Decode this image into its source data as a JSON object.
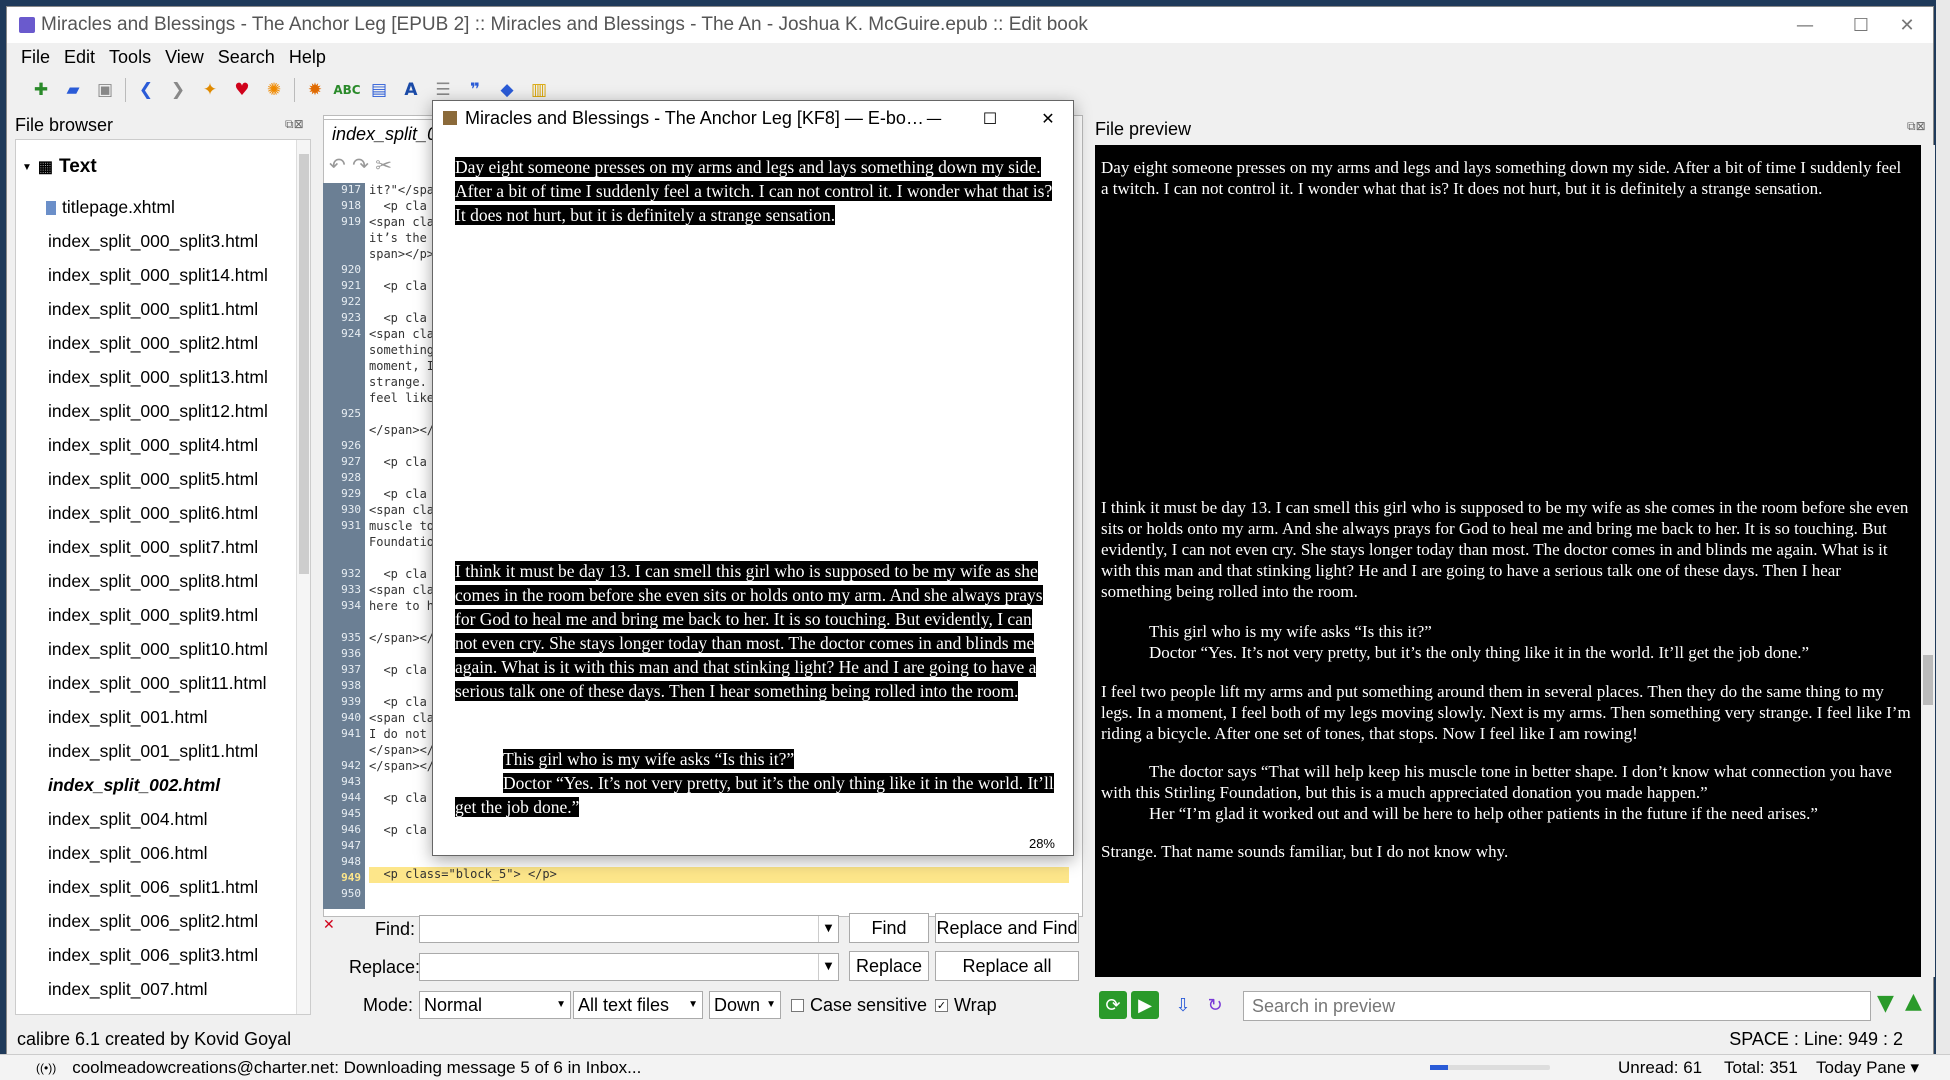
{
  "window": {
    "title": "Miracles and Blessings - The Anchor Leg [EPUB 2] :: Miracles and Blessings - The An - Joshua K. McGuire.epub :: Edit book",
    "minimize": "—",
    "maximize": "☐",
    "close": "✕"
  },
  "menu": [
    "File",
    "Edit",
    "Tools",
    "View",
    "Search",
    "Help"
  ],
  "file_browser": {
    "header": "File browser",
    "root": "Text",
    "items": [
      "titlepage.xhtml",
      "index_split_000_split3.html",
      "index_split_000_split14.html",
      "index_split_000_split1.html",
      "index_split_000_split2.html",
      "index_split_000_split13.html",
      "index_split_000_split12.html",
      "index_split_000_split4.html",
      "index_split_000_split5.html",
      "index_split_000_split6.html",
      "index_split_000_split7.html",
      "index_split_000_split8.html",
      "index_split_000_split9.html",
      "index_split_000_split10.html",
      "index_split_000_split11.html",
      "index_split_001.html",
      "index_split_001_split1.html",
      "index_split_002.html",
      "index_split_004.html",
      "index_split_006.html",
      "index_split_006_split1.html",
      "index_split_006_split2.html",
      "index_split_006_split3.html",
      "index_split_007.html"
    ],
    "active_item": "index_split_002.html"
  },
  "editor": {
    "tab": "index_split_0",
    "gutter": [
      "917",
      "918",
      "919",
      "",
      "",
      "920",
      "921",
      "922",
      "923",
      "924",
      "",
      "",
      "",
      "",
      "925",
      "",
      "926",
      "927",
      "928",
      "929",
      "930",
      "931",
      "",
      "",
      "932",
      "933",
      "934",
      "",
      "935",
      "936",
      "937",
      "938",
      "939",
      "940",
      "941",
      "",
      "942",
      "943",
      "944",
      "945",
      "946",
      "947",
      "948",
      "949",
      "950"
    ],
    "lines": [
      "it?\"</spa",
      "  <p cla",
      "<span cla",
      "it’s the ",
      "span></p>",
      "",
      "  <p cla",
      "",
      "  <p cla",
      "<span cla",
      "something",
      "moment, I",
      "strange.",
      "feel like",
      "",
      "</span></",
      "",
      "  <p cla",
      "",
      "  <p cla",
      "<span cla",
      "muscle to",
      "Foundatio",
      "",
      "  <p cla",
      "<span cla",
      "here to h",
      "",
      "</span></",
      "",
      "  <p cla",
      "",
      "  <p cla",
      "<span cla",
      "I do not ",
      "</span></",
      "</span></",
      "",
      "  <p cla",
      "",
      "  <p cla",
      ""
    ],
    "current_line": "  <p class=\"block_5\"> </p>"
  },
  "popup": {
    "title": "Miracles and Blessings - The Anchor Leg [KF8] — E-bo…",
    "para1": "Day eight someone presses on my arms and legs and lays something down my side. After a bit of time I suddenly feel a twitch. I can not control it. I wonder what that is? It does not hurt, but it is definitely a strange sensation.",
    "para2": "I think it must be day 13. I can smell this girl who is supposed to be my wife as she comes in the room before she even sits or holds onto my arm. And she always prays for God to heal me and bring me back to her. It is so touching. But evidently, I can not even cry. She stays longer today than most. The doctor comes in and blinds me again. What is it with this man and that stinking light? He and I are going to have a serious talk one of these days. Then I hear something being rolled into the room.",
    "para3a": "This girl who is my wife asks “Is this it?”",
    "para3b": "Doctor “Yes. It’s not very pretty, but it’s the only thing like it in the world. It’ll get the job done.”",
    "percent": "28%"
  },
  "find_replace": {
    "find_label": "Find:",
    "replace_label": "Replace:",
    "mode_label": "Mode:",
    "find_btn": "Find",
    "replace_find_btn": "Replace and Find",
    "replace_btn": "Replace",
    "replace_all_btn": "Replace all",
    "mode_value": "Normal",
    "scope_value": "All text files",
    "direction_value": "Down",
    "case_label": "Case sensitive",
    "wrap_label": "Wrap"
  },
  "file_preview": {
    "header": "File preview",
    "p1": "Day eight someone presses on my arms and legs and lays something down my side. After a bit of time I suddenly feel a twitch. I can not control it. I wonder what that is? It does not hurt, but it is definitely a strange sensation.",
    "p2": "I think it must be day 13. I can smell this girl who is supposed to be my wife as she comes in the room before she even sits or holds onto my arm. And she always prays for God to heal me and bring me back to her. It is so touching. But evidently, I can not even cry. She stays longer today than most. The doctor comes in and blinds me again. What is it with this man and that stinking light? He and I are going to have a serious talk one of these days. Then I hear something being rolled into the room.",
    "p3a": "This girl who is my wife asks “Is this it?”",
    "p3b": "Doctor “Yes. It’s not very pretty, but it’s the only thing like it in the world. It’ll get the job done.”",
    "p4": "I feel two people lift my arms and put something around them in several places. Then they do the same thing to my legs. In a moment, I feel both of my legs moving slowly. Next is my arms. Then something very strange. I feel like I’m riding a bicycle. After one set of tones, that stops. Now I feel like I am rowing!",
    "p5a": "The doctor says “That will help keep his muscle tone in better shape. I don’t know what connection you have with this Stirling Foundation, but this is a much appreciated donation you made happen.”",
    "p5b": "Her “I’m glad it worked out and will be here to help other patients in the future if the need arises.”",
    "p6": "Strange. That name sounds familiar, but I do not know why.",
    "search_placeholder": "Search in preview"
  },
  "status": {
    "left": "calibre 6.1 created by Kovid Goyal",
    "right": "SPACE : Line: 949 : 2"
  },
  "taskbar": {
    "message": "coolmeadowcreations@charter.net: Downloading message 5 of 6 in Inbox...",
    "unread": "Unread: 61",
    "total": "Total: 351",
    "today": "Today Pane ▾"
  }
}
